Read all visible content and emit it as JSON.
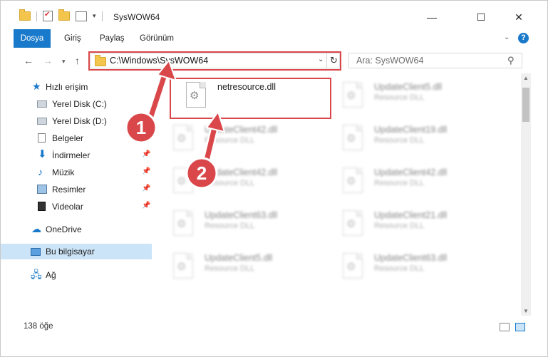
{
  "window": {
    "title": "SysWOW64"
  },
  "title_controls": {
    "minimize": "—",
    "maximize": "☐",
    "close": "✕"
  },
  "ribbon": {
    "tabs": [
      "Dosya",
      "Giriş",
      "Paylaş",
      "Görünüm"
    ],
    "expand_icon": "chevron-down-icon",
    "help": "?"
  },
  "nav": {
    "address": "C:\\Windows\\SysWOW64",
    "search_placeholder": "Ara: SysWOW64"
  },
  "sidebar": {
    "items": [
      {
        "label": "Hızlı erişim",
        "icon": "star-icon"
      },
      {
        "label": "Yerel Disk (C:)",
        "icon": "drive-icon"
      },
      {
        "label": "Yerel Disk (D:)",
        "icon": "drive-icon"
      },
      {
        "label": "Belgeler",
        "icon": "documents-icon"
      },
      {
        "label": "İndirmeler",
        "icon": "downloads-icon"
      },
      {
        "label": "Müzik",
        "icon": "music-icon"
      },
      {
        "label": "Resimler",
        "icon": "pictures-icon"
      },
      {
        "label": "Videolar",
        "icon": "videos-icon"
      },
      {
        "label": "OneDrive",
        "icon": "cloud-icon"
      },
      {
        "label": "Bu bilgisayar",
        "icon": "computer-icon"
      },
      {
        "label": "Ağ",
        "icon": "network-icon"
      }
    ]
  },
  "files": [
    {
      "name": "netresource.dll",
      "type": ""
    },
    {
      "name": "UpdateClient5.dll",
      "type": "Resource DLL"
    },
    {
      "name": "UpdateClient42.dll",
      "type": "Resource DLL"
    },
    {
      "name": "UpdateClient19.dll",
      "type": "Resource DLL"
    },
    {
      "name": "UpdateClient42.dll",
      "type": "Resource DLL"
    },
    {
      "name": "UpdateClient42.dll",
      "type": "Resource DLL"
    },
    {
      "name": "UpdateClient63.dll",
      "type": "Resource DLL"
    },
    {
      "name": "UpdateClient21.dll",
      "type": "Resource DLL"
    },
    {
      "name": "UpdateClient5.dll",
      "type": "Resource DLL"
    },
    {
      "name": "UpdateClient63.dll",
      "type": "Resource DLL"
    }
  ],
  "status": {
    "item_count": "138 öğe"
  },
  "annotations": {
    "step1": "1",
    "step2": "2",
    "color": "#d9474a"
  }
}
